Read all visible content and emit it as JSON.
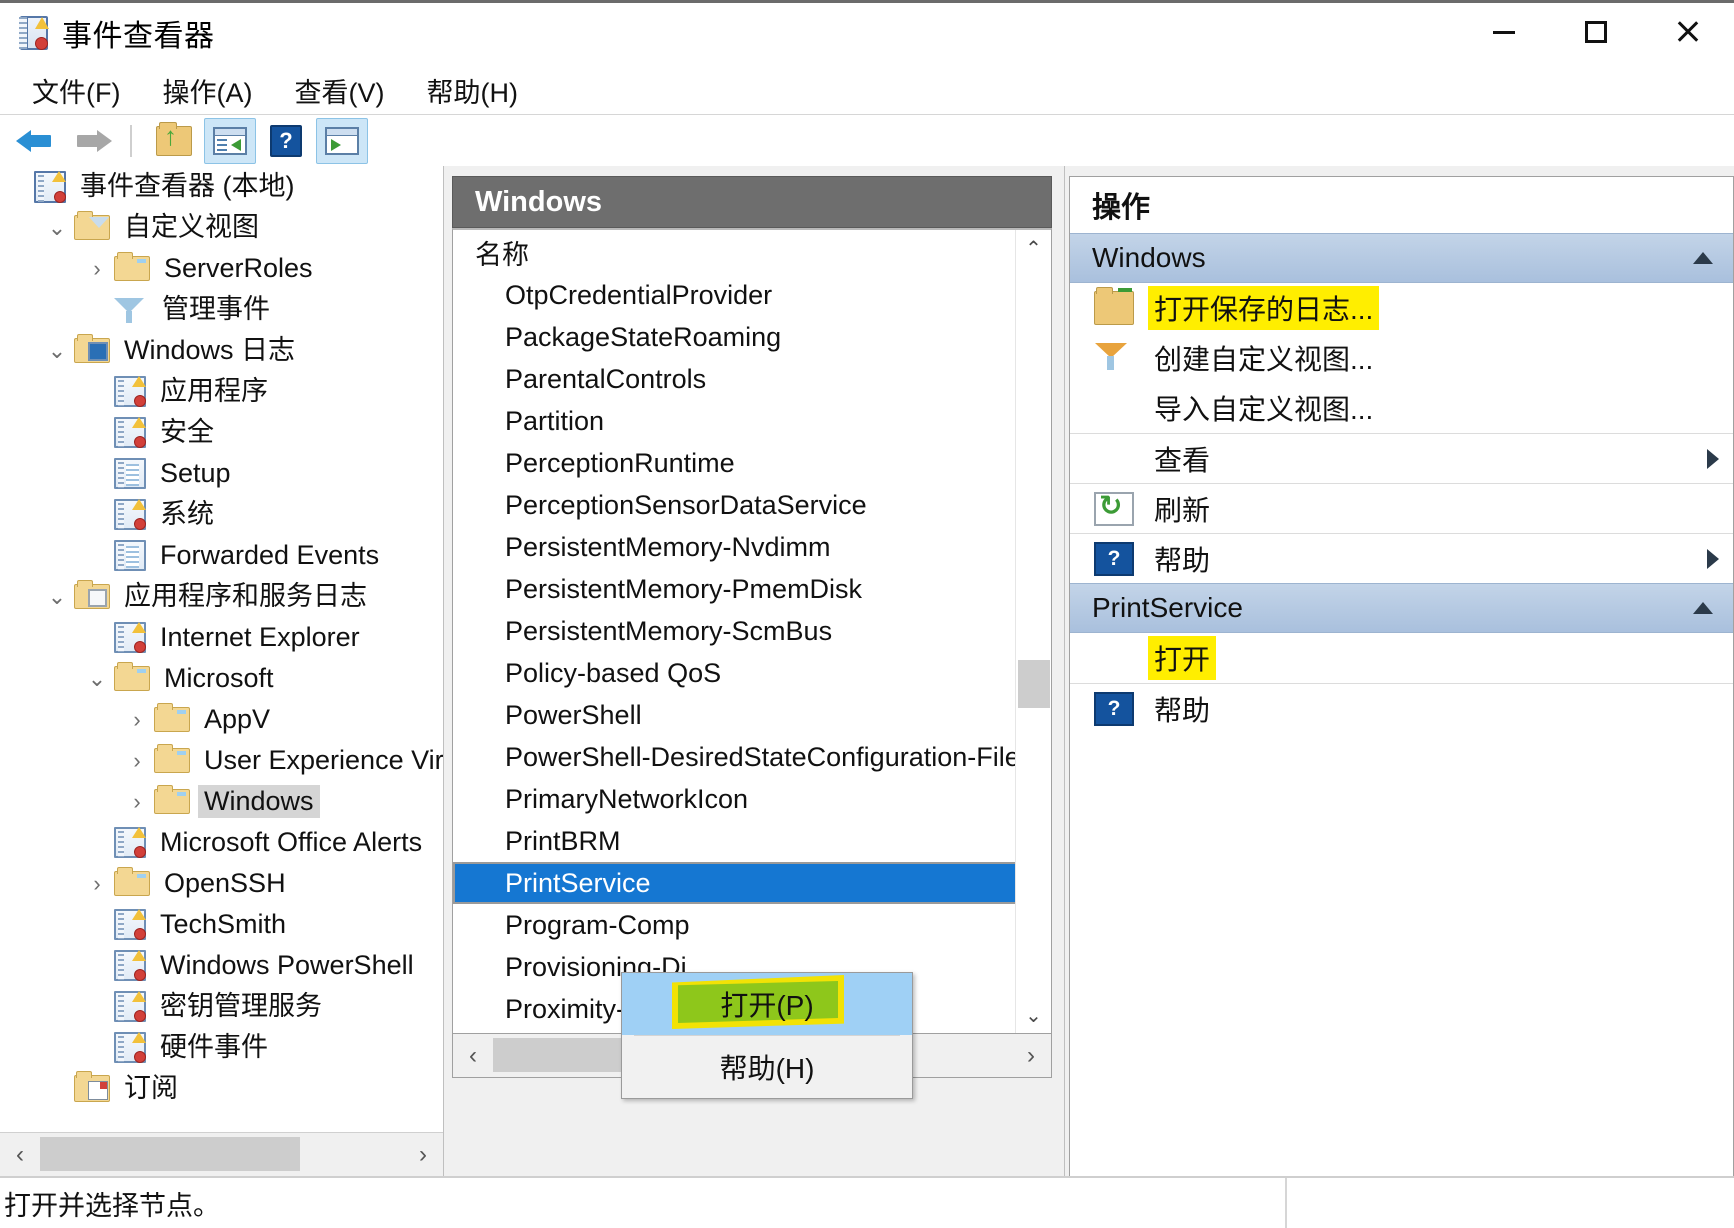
{
  "window": {
    "title": "事件查看器",
    "app_icon": "event-viewer-icon",
    "minimize": "—",
    "maximize": "□",
    "close": "✕"
  },
  "menubar": {
    "items": [
      {
        "label": "文件(F)"
      },
      {
        "label": "操作(A)"
      },
      {
        "label": "查看(V)"
      },
      {
        "label": "帮助(H)"
      }
    ]
  },
  "toolbar": {
    "buttons": [
      {
        "name": "back-button",
        "icon": "back-arrow-icon",
        "active": false
      },
      {
        "name": "forward-button",
        "icon": "forward-arrow-icon",
        "active": false
      },
      {
        "name": "up-one-level-button",
        "icon": "folder-up-icon",
        "active": false
      },
      {
        "name": "show-hide-console-tree-button",
        "icon": "console-tree-icon",
        "active": true
      },
      {
        "name": "help-button",
        "icon": "help-icon",
        "active": false
      },
      {
        "name": "show-hide-action-pane-button",
        "icon": "action-pane-icon",
        "active": true
      }
    ]
  },
  "tree": {
    "items": [
      {
        "label": "事件查看器 (本地)",
        "indent": 0,
        "twisty": "",
        "icon": "event-viewer-icon",
        "selected": false
      },
      {
        "label": "自定义视图",
        "indent": 1,
        "twisty": "⌄",
        "icon": "folder-filter-icon",
        "selected": false
      },
      {
        "label": "ServerRoles",
        "indent": 2,
        "twisty": "›",
        "icon": "folder-icon",
        "selected": false
      },
      {
        "label": "管理事件",
        "indent": 2,
        "twisty": "",
        "icon": "funnel-icon",
        "selected": false
      },
      {
        "label": "Windows 日志",
        "indent": 1,
        "twisty": "⌄",
        "icon": "folder-monitor-icon",
        "selected": false
      },
      {
        "label": "应用程序",
        "indent": 2,
        "twisty": "",
        "icon": "log-icon",
        "selected": false
      },
      {
        "label": "安全",
        "indent": 2,
        "twisty": "",
        "icon": "log-icon",
        "selected": false
      },
      {
        "label": "Setup",
        "indent": 2,
        "twisty": "",
        "icon": "log-plain-icon",
        "selected": false
      },
      {
        "label": "系统",
        "indent": 2,
        "twisty": "",
        "icon": "log-icon",
        "selected": false
      },
      {
        "label": "Forwarded Events",
        "indent": 2,
        "twisty": "",
        "icon": "log-plain-icon",
        "selected": false
      },
      {
        "label": "应用程序和服务日志",
        "indent": 1,
        "twisty": "⌄",
        "icon": "folder-window-icon",
        "selected": false
      },
      {
        "label": "Internet Explorer",
        "indent": 2,
        "twisty": "",
        "icon": "log-icon",
        "selected": false
      },
      {
        "label": "Microsoft",
        "indent": 2,
        "twisty": "⌄",
        "icon": "folder-icon",
        "selected": false
      },
      {
        "label": "AppV",
        "indent": 3,
        "twisty": "›",
        "icon": "folder-icon",
        "selected": false
      },
      {
        "label": "User Experience Virtu",
        "indent": 3,
        "twisty": "›",
        "icon": "folder-icon",
        "selected": false
      },
      {
        "label": "Windows",
        "indent": 3,
        "twisty": "›",
        "icon": "folder-icon",
        "selected": true
      },
      {
        "label": "Microsoft Office Alerts",
        "indent": 2,
        "twisty": "",
        "icon": "log-icon",
        "selected": false
      },
      {
        "label": "OpenSSH",
        "indent": 2,
        "twisty": "›",
        "icon": "folder-icon",
        "selected": false
      },
      {
        "label": "TechSmith",
        "indent": 2,
        "twisty": "",
        "icon": "log-icon",
        "selected": false
      },
      {
        "label": "Windows PowerShell",
        "indent": 2,
        "twisty": "",
        "icon": "log-icon",
        "selected": false
      },
      {
        "label": "密钥管理服务",
        "indent": 2,
        "twisty": "",
        "icon": "log-icon",
        "selected": false
      },
      {
        "label": "硬件事件",
        "indent": 2,
        "twisty": "",
        "icon": "log-icon",
        "selected": false
      },
      {
        "label": "订阅",
        "indent": 1,
        "twisty": "",
        "icon": "subscription-icon",
        "selected": false
      }
    ],
    "hscroll": {
      "left_arrow": "‹",
      "right_arrow": "›"
    }
  },
  "list": {
    "header_title": "Windows",
    "column_header": "名称",
    "rows": [
      {
        "name": "OtpCredentialProvider",
        "selected": false
      },
      {
        "name": "PackageStateRoaming",
        "selected": false
      },
      {
        "name": "ParentalControls",
        "selected": false
      },
      {
        "name": "Partition",
        "selected": false
      },
      {
        "name": "PerceptionRuntime",
        "selected": false
      },
      {
        "name": "PerceptionSensorDataService",
        "selected": false
      },
      {
        "name": "PersistentMemory-Nvdimm",
        "selected": false
      },
      {
        "name": "PersistentMemory-PmemDisk",
        "selected": false
      },
      {
        "name": "PersistentMemory-ScmBus",
        "selected": false
      },
      {
        "name": "Policy-based QoS",
        "selected": false
      },
      {
        "name": "PowerShell",
        "selected": false
      },
      {
        "name": "PowerShell-DesiredStateConfiguration-FileDow",
        "selected": false
      },
      {
        "name": "PrimaryNetworkIcon",
        "selected": false
      },
      {
        "name": "PrintBRM",
        "selected": false
      },
      {
        "name": "PrintService",
        "selected": true
      },
      {
        "name": "Program-Comp",
        "selected": false
      },
      {
        "name": "Provisioning-Di",
        "selected": false
      },
      {
        "name": "Proximity-Common",
        "selected": false
      }
    ],
    "vscroll": {
      "up_arrow": "⌃",
      "down_arrow": "⌄"
    },
    "hscroll": {
      "left_arrow": "‹",
      "right_arrow": "›"
    }
  },
  "context_menu": {
    "items": [
      {
        "label": "打开(P)",
        "hover": true,
        "highlight": "green-yellow"
      },
      {
        "label": "帮助(H)",
        "hover": false,
        "highlight": ""
      }
    ]
  },
  "actions": {
    "title": "操作",
    "groups": [
      {
        "name": "Windows",
        "collapse_icon": "chevron-up-icon",
        "items": [
          {
            "label": "打开保存的日志...",
            "icon": "open-saved-log-icon",
            "highlight": "yellow",
            "submenu": false,
            "separator": false
          },
          {
            "label": "创建自定义视图...",
            "icon": "funnel-icon",
            "highlight": "",
            "submenu": false,
            "separator": false
          },
          {
            "label": "导入自定义视图...",
            "icon": "",
            "highlight": "",
            "submenu": false,
            "separator": false
          },
          {
            "label": "查看",
            "icon": "",
            "highlight": "",
            "submenu": true,
            "separator": true
          },
          {
            "label": "刷新",
            "icon": "refresh-icon",
            "highlight": "",
            "submenu": false,
            "separator": true
          },
          {
            "label": "帮助",
            "icon": "help-icon",
            "highlight": "",
            "submenu": true,
            "separator": true
          }
        ]
      },
      {
        "name": "PrintService",
        "collapse_icon": "chevron-up-icon",
        "items": [
          {
            "label": "打开",
            "icon": "",
            "highlight": "yellow",
            "submenu": false,
            "separator": false
          },
          {
            "label": "帮助",
            "icon": "help-icon",
            "highlight": "",
            "submenu": false,
            "separator": true
          }
        ]
      }
    ]
  },
  "statusbar": {
    "text": "打开并选择节点。"
  },
  "colors": {
    "selection_blue": "#1577d2",
    "highlight_yellow": "#ffee00",
    "highlight_green": "#8ec71b",
    "group_header_blue": "#a9c0dd",
    "list_header_gray": "#6e6e6e",
    "menu_hover_blue": "#9fd0f5"
  }
}
